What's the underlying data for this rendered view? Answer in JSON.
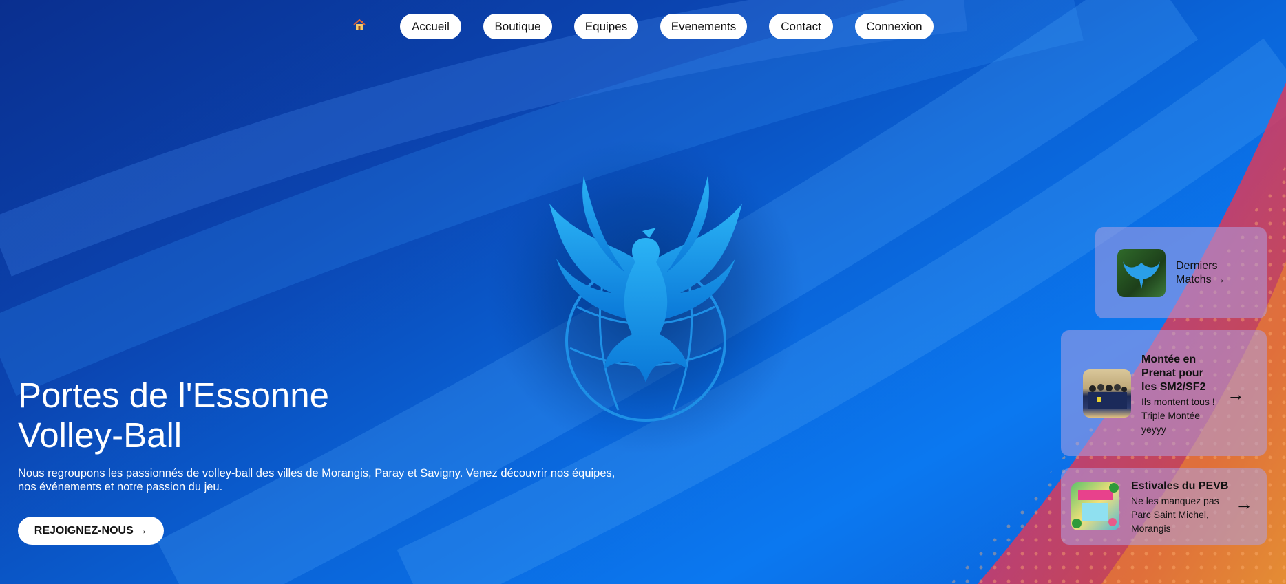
{
  "nav": {
    "home_icon": "home-icon",
    "items": [
      "Accueil",
      "Boutique",
      "Equipes",
      "Evenements",
      "Contact",
      "Connexion"
    ]
  },
  "hero": {
    "title_line1": "Portes de l'Essonne",
    "title_line2": "Volley-Ball",
    "description_line1": "Nous regroupons les passionnés de volley-ball des villes de Morangis, Paray et Savigny. Venez découvrir nos équipes,",
    "description_line2": "nos événements et notre passion du jeu.",
    "cta_label": "REJOIGNEZ-NOUS →"
  },
  "cards": [
    {
      "title_line1": "Derniers",
      "title_line2": "Matchs →"
    },
    {
      "title_lines": [
        "Montée en",
        "Prenat pour",
        "les SM2/SF2"
      ],
      "text_lines": [
        "Ils montent tous !",
        "Triple Montée",
        "yeyyy"
      ],
      "arrow": "→"
    },
    {
      "title": "Estivales du PEVB",
      "text_lines": [
        "Ne les manquez pas",
        "Parc Saint Michel,",
        "Morangis"
      ],
      "arrow": "→"
    }
  ],
  "colors": {
    "background_dark": "#0a2f8f",
    "background_light": "#0b78f0",
    "accent_red": "#e8413c",
    "accent_orange": "#f59a2a",
    "logo_blue": "#1ea7f0"
  }
}
